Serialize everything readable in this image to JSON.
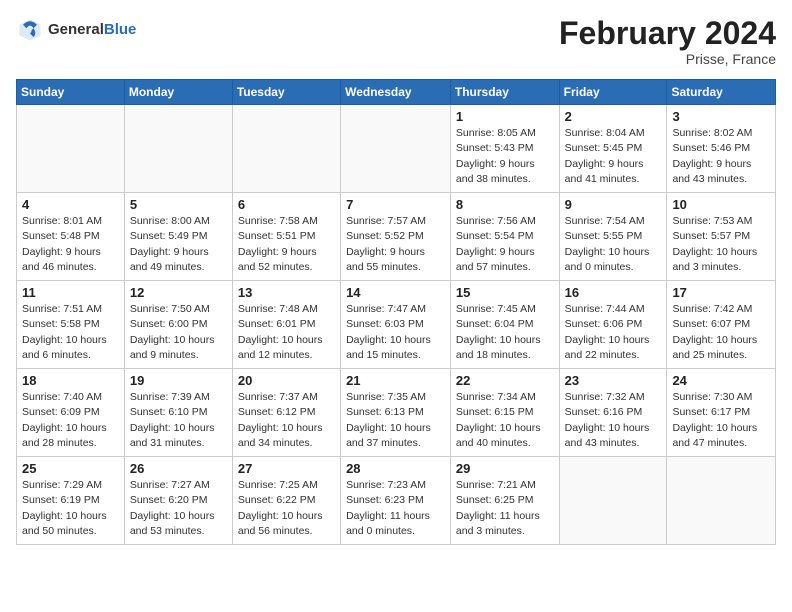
{
  "header": {
    "logo_general": "General",
    "logo_blue": "Blue",
    "month_title": "February 2024",
    "subtitle": "Prisse, France"
  },
  "days_of_week": [
    "Sunday",
    "Monday",
    "Tuesday",
    "Wednesday",
    "Thursday",
    "Friday",
    "Saturday"
  ],
  "weeks": [
    [
      {
        "day": "",
        "info": ""
      },
      {
        "day": "",
        "info": ""
      },
      {
        "day": "",
        "info": ""
      },
      {
        "day": "",
        "info": ""
      },
      {
        "day": "1",
        "info": "Sunrise: 8:05 AM\nSunset: 5:43 PM\nDaylight: 9 hours\nand 38 minutes."
      },
      {
        "day": "2",
        "info": "Sunrise: 8:04 AM\nSunset: 5:45 PM\nDaylight: 9 hours\nand 41 minutes."
      },
      {
        "day": "3",
        "info": "Sunrise: 8:02 AM\nSunset: 5:46 PM\nDaylight: 9 hours\nand 43 minutes."
      }
    ],
    [
      {
        "day": "4",
        "info": "Sunrise: 8:01 AM\nSunset: 5:48 PM\nDaylight: 9 hours\nand 46 minutes."
      },
      {
        "day": "5",
        "info": "Sunrise: 8:00 AM\nSunset: 5:49 PM\nDaylight: 9 hours\nand 49 minutes."
      },
      {
        "day": "6",
        "info": "Sunrise: 7:58 AM\nSunset: 5:51 PM\nDaylight: 9 hours\nand 52 minutes."
      },
      {
        "day": "7",
        "info": "Sunrise: 7:57 AM\nSunset: 5:52 PM\nDaylight: 9 hours\nand 55 minutes."
      },
      {
        "day": "8",
        "info": "Sunrise: 7:56 AM\nSunset: 5:54 PM\nDaylight: 9 hours\nand 57 minutes."
      },
      {
        "day": "9",
        "info": "Sunrise: 7:54 AM\nSunset: 5:55 PM\nDaylight: 10 hours\nand 0 minutes."
      },
      {
        "day": "10",
        "info": "Sunrise: 7:53 AM\nSunset: 5:57 PM\nDaylight: 10 hours\nand 3 minutes."
      }
    ],
    [
      {
        "day": "11",
        "info": "Sunrise: 7:51 AM\nSunset: 5:58 PM\nDaylight: 10 hours\nand 6 minutes."
      },
      {
        "day": "12",
        "info": "Sunrise: 7:50 AM\nSunset: 6:00 PM\nDaylight: 10 hours\nand 9 minutes."
      },
      {
        "day": "13",
        "info": "Sunrise: 7:48 AM\nSunset: 6:01 PM\nDaylight: 10 hours\nand 12 minutes."
      },
      {
        "day": "14",
        "info": "Sunrise: 7:47 AM\nSunset: 6:03 PM\nDaylight: 10 hours\nand 15 minutes."
      },
      {
        "day": "15",
        "info": "Sunrise: 7:45 AM\nSunset: 6:04 PM\nDaylight: 10 hours\nand 18 minutes."
      },
      {
        "day": "16",
        "info": "Sunrise: 7:44 AM\nSunset: 6:06 PM\nDaylight: 10 hours\nand 22 minutes."
      },
      {
        "day": "17",
        "info": "Sunrise: 7:42 AM\nSunset: 6:07 PM\nDaylight: 10 hours\nand 25 minutes."
      }
    ],
    [
      {
        "day": "18",
        "info": "Sunrise: 7:40 AM\nSunset: 6:09 PM\nDaylight: 10 hours\nand 28 minutes."
      },
      {
        "day": "19",
        "info": "Sunrise: 7:39 AM\nSunset: 6:10 PM\nDaylight: 10 hours\nand 31 minutes."
      },
      {
        "day": "20",
        "info": "Sunrise: 7:37 AM\nSunset: 6:12 PM\nDaylight: 10 hours\nand 34 minutes."
      },
      {
        "day": "21",
        "info": "Sunrise: 7:35 AM\nSunset: 6:13 PM\nDaylight: 10 hours\nand 37 minutes."
      },
      {
        "day": "22",
        "info": "Sunrise: 7:34 AM\nSunset: 6:15 PM\nDaylight: 10 hours\nand 40 minutes."
      },
      {
        "day": "23",
        "info": "Sunrise: 7:32 AM\nSunset: 6:16 PM\nDaylight: 10 hours\nand 43 minutes."
      },
      {
        "day": "24",
        "info": "Sunrise: 7:30 AM\nSunset: 6:17 PM\nDaylight: 10 hours\nand 47 minutes."
      }
    ],
    [
      {
        "day": "25",
        "info": "Sunrise: 7:29 AM\nSunset: 6:19 PM\nDaylight: 10 hours\nand 50 minutes."
      },
      {
        "day": "26",
        "info": "Sunrise: 7:27 AM\nSunset: 6:20 PM\nDaylight: 10 hours\nand 53 minutes."
      },
      {
        "day": "27",
        "info": "Sunrise: 7:25 AM\nSunset: 6:22 PM\nDaylight: 10 hours\nand 56 minutes."
      },
      {
        "day": "28",
        "info": "Sunrise: 7:23 AM\nSunset: 6:23 PM\nDaylight: 11 hours\nand 0 minutes."
      },
      {
        "day": "29",
        "info": "Sunrise: 7:21 AM\nSunset: 6:25 PM\nDaylight: 11 hours\nand 3 minutes."
      },
      {
        "day": "",
        "info": ""
      },
      {
        "day": "",
        "info": ""
      }
    ]
  ]
}
